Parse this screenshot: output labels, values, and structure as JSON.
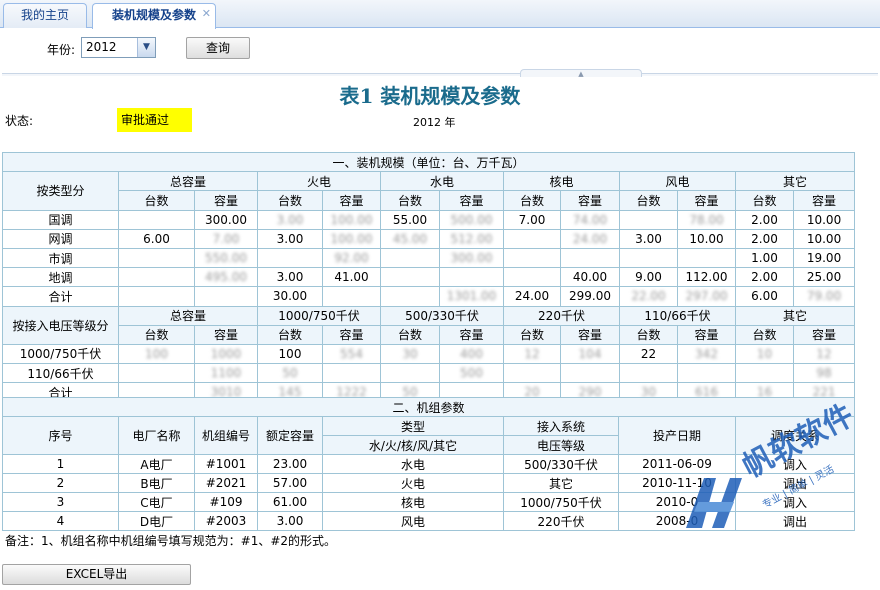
{
  "tabs": [
    {
      "label": "我的主页",
      "active": false
    },
    {
      "label": "装机规模及参数",
      "active": true
    }
  ],
  "filter": {
    "year_label": "年份:",
    "year_value": "2012",
    "query_label": "查询"
  },
  "report": {
    "title": "表1  装机规模及参数",
    "status_label": "状态:",
    "status_value": "审批通过",
    "year_text": "2012 年"
  },
  "section1": {
    "title": "一、装机规模（单位：台、万千瓦）",
    "group1_header": "按类型分",
    "group1_columns": [
      "总容量",
      "火电",
      "水电",
      "核电",
      "风电",
      "其它"
    ],
    "sub_headers": [
      "台数",
      "容量"
    ],
    "type_rows": [
      {
        "label": "国调",
        "cells": [
          "",
          "300.00",
          "3.00",
          "100.00",
          "55.00",
          "500.00",
          "7.00",
          "74.00",
          "",
          "78.00",
          "2.00",
          "10.00"
        ]
      },
      {
        "label": "网调",
        "cells": [
          "6.00",
          "7.00",
          "3.00",
          "100.00",
          "45.00",
          "512.00",
          "",
          "24.00",
          "3.00",
          "10.00",
          "2.00",
          "10.00"
        ]
      },
      {
        "label": "市调",
        "cells": [
          "",
          "550.00",
          "",
          "92.00",
          "",
          "300.00",
          "",
          "",
          "",
          "",
          "1.00",
          "19.00"
        ]
      },
      {
        "label": "地调",
        "cells": [
          "",
          "495.00",
          "3.00",
          "41.00",
          "",
          "",
          "",
          "40.00",
          "9.00",
          "112.00",
          "2.00",
          "25.00"
        ]
      },
      {
        "label": "合计",
        "cells": [
          "",
          "",
          "30.00",
          "",
          "",
          "1301.00",
          "24.00",
          "299.00",
          "22.00",
          "297.00",
          "6.00",
          "79.00"
        ]
      }
    ],
    "group2_header": "按接入电压等级分",
    "group2_columns": [
      "总容量",
      "1000/750千伏",
      "500/330千伏",
      "220千伏",
      "110/66千伏",
      "其它"
    ],
    "voltage_rows": [
      {
        "label": "1000/750千伏",
        "cells": [
          "100",
          "1000",
          "100",
          "554",
          "30",
          "400",
          "12",
          "104",
          "22",
          "342",
          "10",
          "12"
        ]
      },
      {
        "label": "110/66千伏",
        "cells": [
          "",
          "1100",
          "50",
          "",
          "",
          "500",
          "",
          "",
          "",
          "",
          "",
          "98"
        ]
      },
      {
        "label": "合计",
        "cells": [
          "",
          "3010",
          "145",
          "1222",
          "50",
          "",
          "20",
          "290",
          "30",
          "616",
          "16",
          "221"
        ]
      }
    ]
  },
  "section2": {
    "title": "二、机组参数",
    "headers": {
      "index": "序号",
      "plant": "电厂名称",
      "unit": "机组编号",
      "capacity": "额定容量",
      "type": "类型",
      "type_sub": "水/火/核/风/其它",
      "access": "接入系统",
      "access_sub": "电压等级",
      "date": "投产日期",
      "dispatch": "调度关系"
    },
    "rows": [
      {
        "index": "1",
        "plant": "A电厂",
        "unit": "#1001",
        "capacity": "23.00",
        "type": "水电",
        "voltage": "500/330千伏",
        "date": "2011-06-09",
        "dispatch": "调入"
      },
      {
        "index": "2",
        "plant": "B电厂",
        "unit": "#2021",
        "capacity": "57.00",
        "type": "火电",
        "voltage": "其它",
        "date": "2010-11-10",
        "dispatch": "调出"
      },
      {
        "index": "3",
        "plant": "C电厂",
        "unit": "#109",
        "capacity": "61.00",
        "type": "核电",
        "voltage": "1000/750千伏",
        "date": "2010-0",
        "dispatch": "调入"
      },
      {
        "index": "4",
        "plant": "D电厂",
        "unit": "#2003",
        "capacity": "3.00",
        "type": "风电",
        "voltage": "220千伏",
        "date": "2008-0",
        "dispatch": "调出"
      }
    ]
  },
  "note": "备注：1、机组名称中机组编号填写规范为：#1、#2的形式。",
  "export_label": "EXCEL导出",
  "watermark": {
    "brand": "帆软软件",
    "slogan": "专业 | 简单 | 灵活",
    "color": "#1f5fb8"
  },
  "colors": {
    "title": "#1a6b8c",
    "header_bg": "#edf5fb",
    "border": "#9ec4d6",
    "status_bg": "#ffff00",
    "tab_text": "#15428b"
  }
}
